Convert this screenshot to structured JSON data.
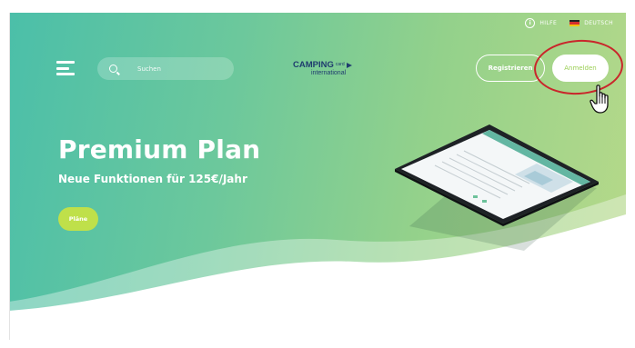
{
  "topbar": {
    "help_label": "HILFE",
    "language_label": "DEUTSCH",
    "icons": {
      "help": "info-icon",
      "language": "flag-de-icon"
    }
  },
  "header": {
    "search": {
      "placeholder": "Suchen",
      "value": ""
    },
    "logo": {
      "line1": "CAMPING",
      "line1_small": "card",
      "line2": "international"
    },
    "register_label": "Registrieren",
    "login_label": "Anmelden"
  },
  "hero": {
    "title": "Premium Plan",
    "subtitle": "Neue Funktionen für 125€/Jahr",
    "plans_button_label": "Pläne"
  },
  "colors": {
    "gradient_start": "#4bbfa9",
    "gradient_end": "#b7d989",
    "accent_green": "#bfe04a",
    "login_text": "#9bcf55",
    "logo_blue": "#1f3c6e",
    "annotation_red": "#c9262b"
  }
}
